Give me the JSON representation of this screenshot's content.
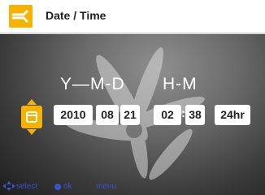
{
  "titlebar": {
    "title": "Date / Time",
    "icon": "scissors-wrench-icon"
  },
  "format_header": {
    "ymd": "Y—M-D",
    "hm": "H-M"
  },
  "fields": {
    "year": "2010",
    "month": "08",
    "day": "21",
    "hour": "02",
    "separator": ":",
    "minute": "38",
    "clock_mode": "24hr"
  },
  "selector": {
    "icon": "calendar-icon",
    "up_icon": "arrow-up-icon",
    "down_icon": "arrow-down-icon"
  },
  "footer": {
    "select_label": "select",
    "ok_label": "ok",
    "menu_label": "menu"
  },
  "colors": {
    "accent": "#f5b300",
    "footer_text": "#3b52c8"
  }
}
